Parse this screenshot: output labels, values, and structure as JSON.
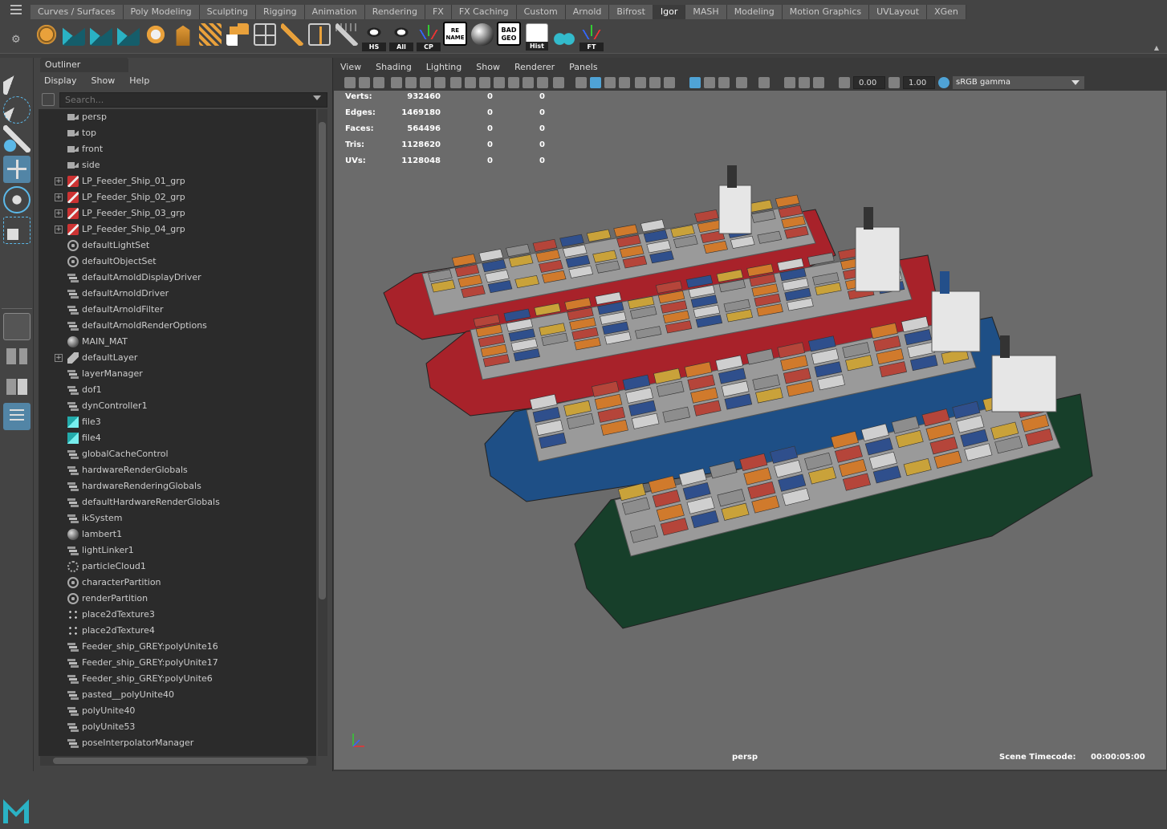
{
  "shelf": {
    "tabs": [
      "Curves / Surfaces",
      "Poly Modeling",
      "Sculpting",
      "Rigging",
      "Animation",
      "Rendering",
      "FX",
      "FX Caching",
      "Custom",
      "Arnold",
      "Bifrost",
      "Igor",
      "MASH",
      "Modeling",
      "Motion Graphics",
      "UVLayout",
      "XGen"
    ],
    "active_tab": "Igor",
    "icon_labels": {
      "hs": "HS",
      "all": "All",
      "cp": "CP",
      "rename": "RE NAME",
      "badgeo": "BAD GEO",
      "hist": "Hist",
      "ft": "FT"
    }
  },
  "outliner": {
    "tab_title": "Outliner",
    "menu": [
      "Display",
      "Show",
      "Help"
    ],
    "search_placeholder": "Search...",
    "items": [
      {
        "label": "persp",
        "icon": "camera-icon",
        "expandable": false
      },
      {
        "label": "top",
        "icon": "camera-icon",
        "expandable": false
      },
      {
        "label": "front",
        "icon": "camera-icon",
        "expandable": false
      },
      {
        "label": "side",
        "icon": "camera-icon",
        "expandable": false
      },
      {
        "label": "LP_Feeder_Ship_01_grp",
        "icon": "group-icon",
        "expandable": true
      },
      {
        "label": "LP_Feeder_Ship_02_grp",
        "icon": "group-icon",
        "expandable": true
      },
      {
        "label": "LP_Feeder_Ship_03_grp",
        "icon": "group-icon",
        "expandable": true
      },
      {
        "label": "LP_Feeder_Ship_04_grp",
        "icon": "group-icon",
        "expandable": true
      },
      {
        "label": "defaultLightSet",
        "icon": "set-icon",
        "expandable": false
      },
      {
        "label": "defaultObjectSet",
        "icon": "set-icon",
        "expandable": false
      },
      {
        "label": "defaultArnoldDisplayDriver",
        "icon": "node-icon",
        "expandable": false
      },
      {
        "label": "defaultArnoldDriver",
        "icon": "node-icon",
        "expandable": false
      },
      {
        "label": "defaultArnoldFilter",
        "icon": "node-icon",
        "expandable": false
      },
      {
        "label": "defaultArnoldRenderOptions",
        "icon": "node-icon",
        "expandable": false
      },
      {
        "label": "MAIN_MAT",
        "icon": "sphere-icon",
        "expandable": false
      },
      {
        "label": "defaultLayer",
        "icon": "layer-icon",
        "expandable": true
      },
      {
        "label": "layerManager",
        "icon": "node-icon",
        "expandable": false
      },
      {
        "label": "dof1",
        "icon": "node-icon",
        "expandable": false
      },
      {
        "label": "dynController1",
        "icon": "node-icon",
        "expandable": false
      },
      {
        "label": "file3",
        "icon": "file-icon",
        "expandable": false
      },
      {
        "label": "file4",
        "icon": "file-icon",
        "expandable": false
      },
      {
        "label": "globalCacheControl",
        "icon": "node-icon",
        "expandable": false
      },
      {
        "label": "hardwareRenderGlobals",
        "icon": "node-icon",
        "expandable": false
      },
      {
        "label": "hardwareRenderingGlobals",
        "icon": "node-icon",
        "expandable": false
      },
      {
        "label": "defaultHardwareRenderGlobals",
        "icon": "node-icon",
        "expandable": false
      },
      {
        "label": "ikSystem",
        "icon": "node-icon",
        "expandable": false
      },
      {
        "label": "lambert1",
        "icon": "sphere-icon",
        "expandable": false
      },
      {
        "label": "lightLinker1",
        "icon": "node-icon",
        "expandable": false
      },
      {
        "label": "particleCloud1",
        "icon": "particle-icon",
        "expandable": false
      },
      {
        "label": "characterPartition",
        "icon": "partition-icon",
        "expandable": false
      },
      {
        "label": "renderPartition",
        "icon": "partition-icon",
        "expandable": false
      },
      {
        "label": "place2dTexture3",
        "icon": "place2d-icon",
        "expandable": false
      },
      {
        "label": "place2dTexture4",
        "icon": "place2d-icon",
        "expandable": false
      },
      {
        "label": "Feeder_ship_GREY:polyUnite16",
        "icon": "node-icon",
        "expandable": false
      },
      {
        "label": "Feeder_ship_GREY:polyUnite17",
        "icon": "node-icon",
        "expandable": false
      },
      {
        "label": "Feeder_ship_GREY:polyUnite6",
        "icon": "node-icon",
        "expandable": false
      },
      {
        "label": "pasted__polyUnite40",
        "icon": "node-icon",
        "expandable": false
      },
      {
        "label": "polyUnite40",
        "icon": "node-icon",
        "expandable": false
      },
      {
        "label": "polyUnite53",
        "icon": "node-icon",
        "expandable": false
      },
      {
        "label": "poseInterpolatorManager",
        "icon": "node-icon",
        "expandable": false
      }
    ]
  },
  "viewport": {
    "menu": [
      "View",
      "Shading",
      "Lighting",
      "Show",
      "Renderer",
      "Panels"
    ],
    "exposure": "0.00",
    "gamma": "1.00",
    "color_space": "sRGB gamma",
    "hud": [
      {
        "label": "Verts:",
        "v1": "932460",
        "v2": "0",
        "v3": "0"
      },
      {
        "label": "Edges:",
        "v1": "1469180",
        "v2": "0",
        "v3": "0"
      },
      {
        "label": "Faces:",
        "v1": "564496",
        "v2": "0",
        "v3": "0"
      },
      {
        "label": "Tris:",
        "v1": "1128620",
        "v2": "0",
        "v3": "0"
      },
      {
        "label": "UVs:",
        "v1": "1128048",
        "v2": "0",
        "v3": "0"
      }
    ],
    "camera": "persp",
    "timecode_label": "Scene Timecode:",
    "timecode_value": "00:00:05:00",
    "hull_colors": [
      "#a8222a",
      "#a8222a",
      "#1e4f86",
      "#173f2a"
    ],
    "container_colors": [
      "#c9a23a",
      "#2f4f8c",
      "#b5453a",
      "#8d8d8d",
      "#cfcfcf",
      "#d07a2c"
    ]
  }
}
